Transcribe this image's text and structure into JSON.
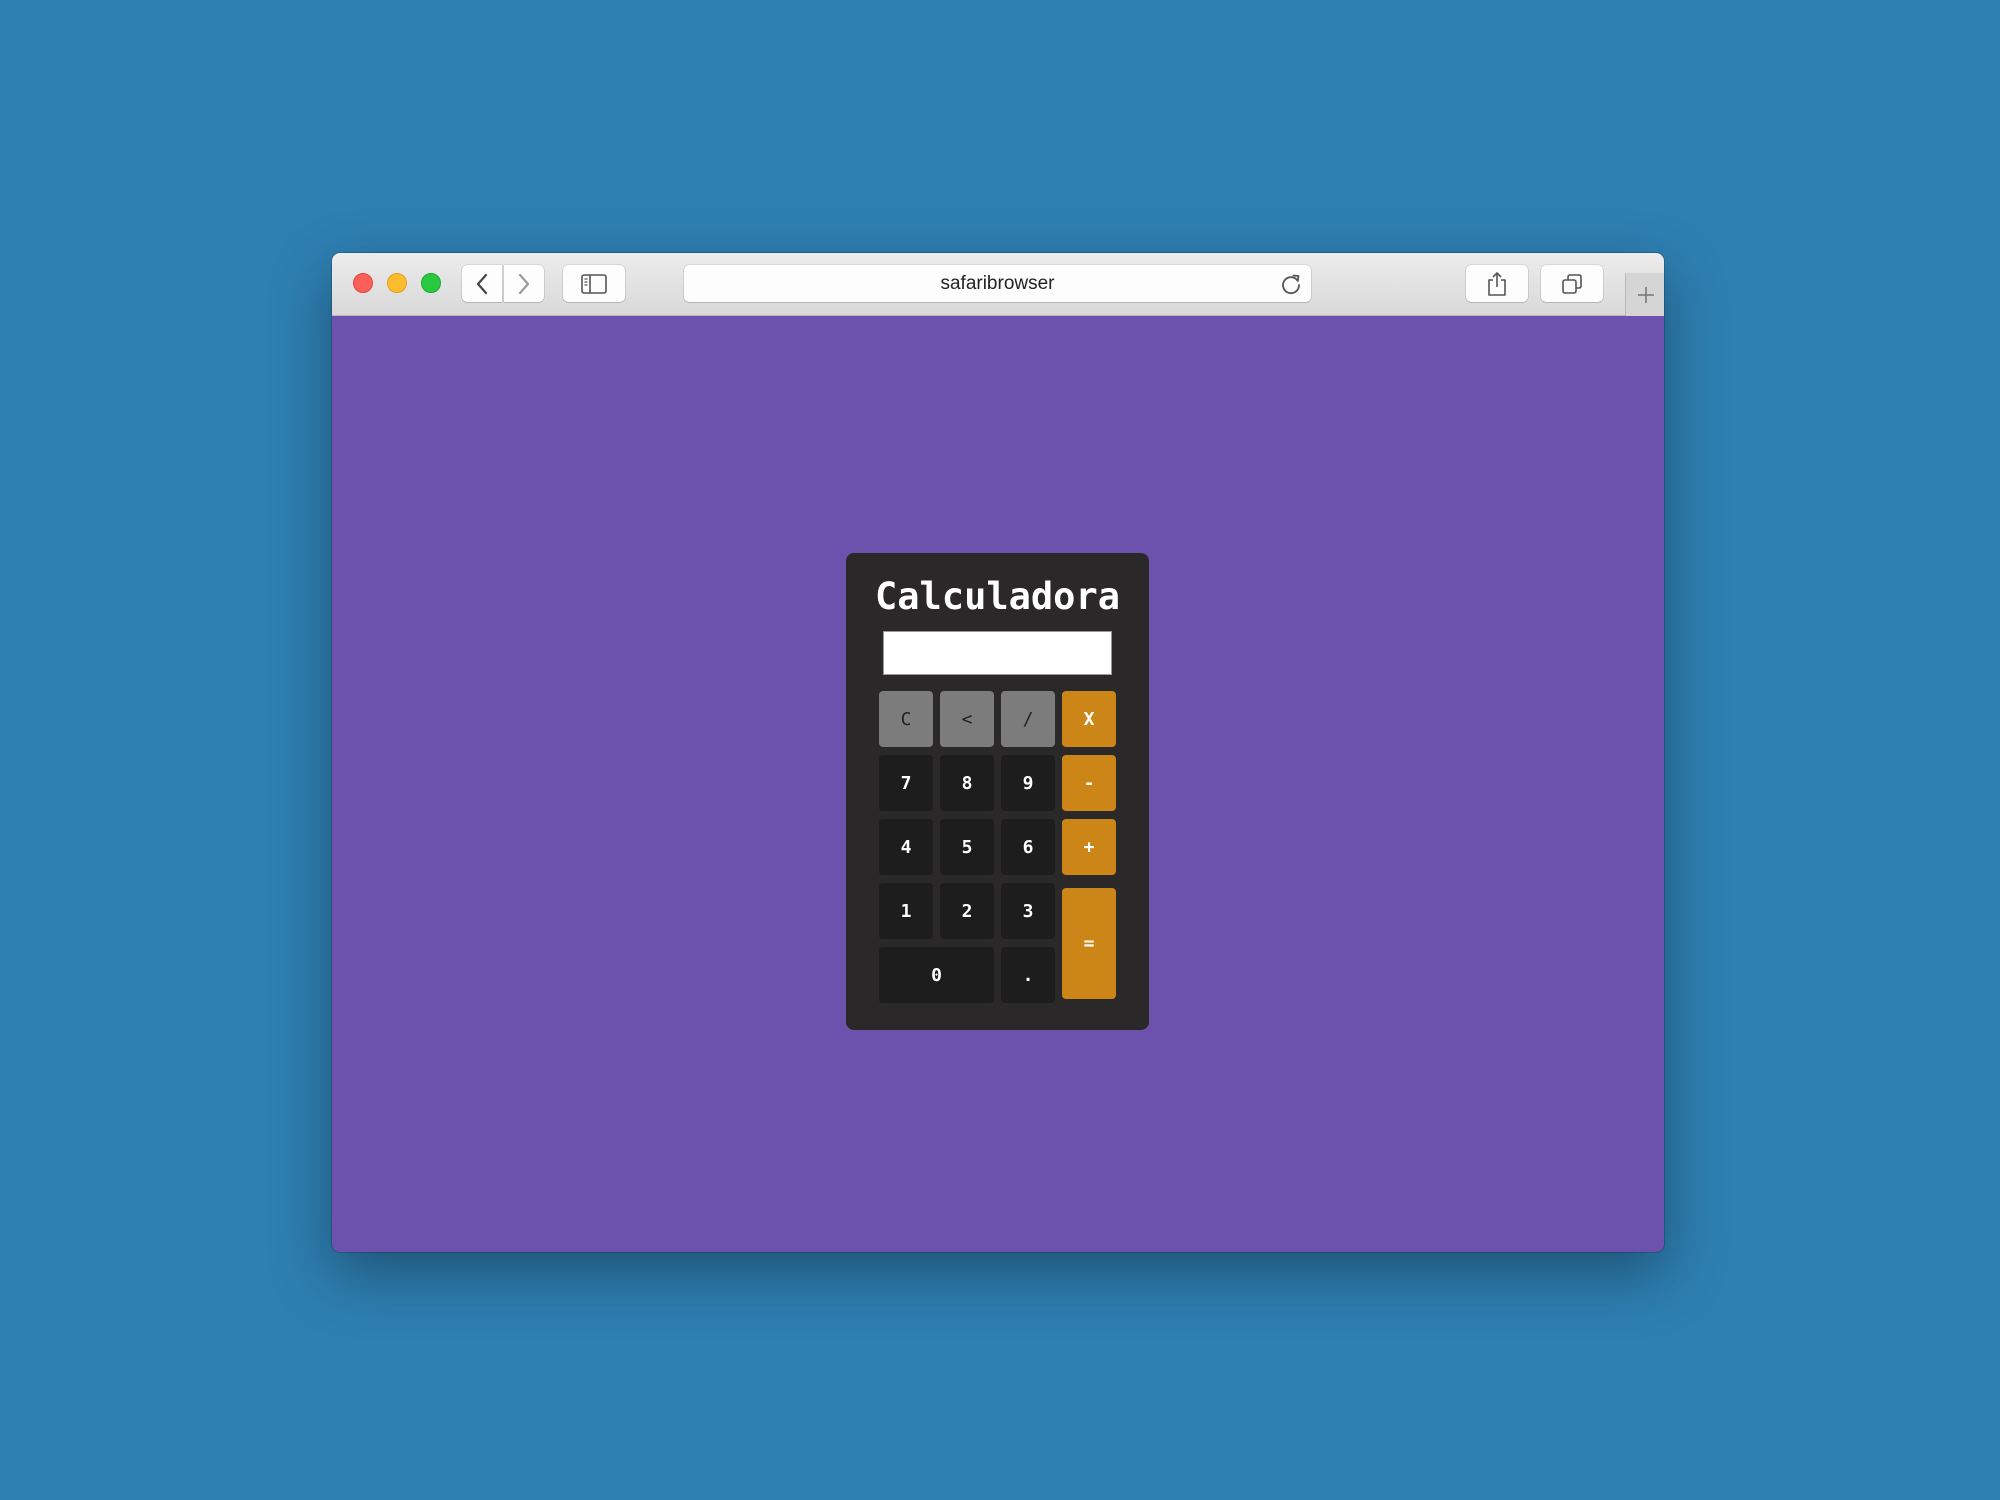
{
  "browser": {
    "address": "safaribrowser",
    "icons": {
      "close": "close-icon",
      "minimize": "minimize-icon",
      "maximize": "maximize-icon",
      "back": "chevron-left-icon",
      "forward": "chevron-right-icon",
      "sidebar": "sidebar-icon",
      "reload": "reload-icon",
      "share": "share-icon",
      "tabs": "tabs-icon",
      "new_tab": "plus-icon"
    }
  },
  "page": {
    "background": "#6c52ac"
  },
  "calculator": {
    "title": "Calculadora",
    "display_value": "",
    "colors": {
      "body": "#2a2828",
      "function_key": "#7c7c7c",
      "operator_key": "#cc8618",
      "digit_key": "#1d1d1d"
    },
    "keys": {
      "clear": "C",
      "backspace": "<",
      "divide": "/",
      "multiply": "X",
      "seven": "7",
      "eight": "8",
      "nine": "9",
      "subtract": "-",
      "four": "4",
      "five": "5",
      "six": "6",
      "add": "+",
      "one": "1",
      "two": "2",
      "three": "3",
      "equals": "=",
      "zero": "0",
      "decimal": "."
    }
  }
}
